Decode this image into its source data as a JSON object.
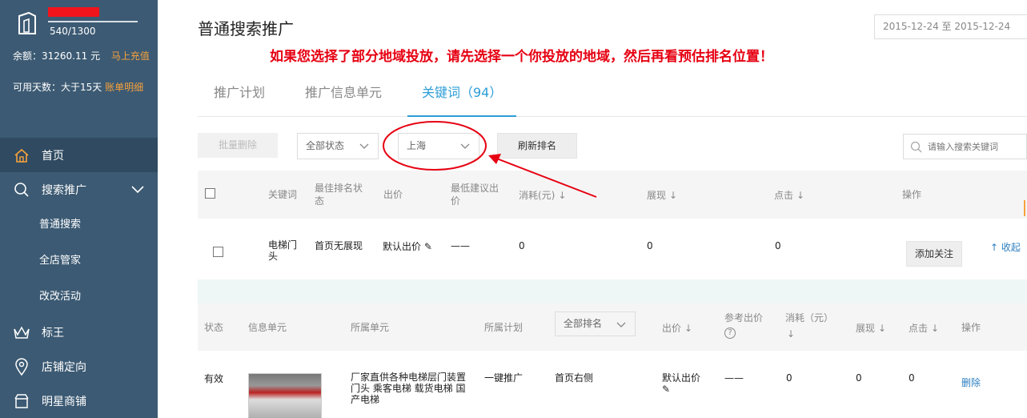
{
  "sidebar": {
    "score": "540/1300",
    "balance_label": "余额：31260.11 元",
    "recharge_link": "马上充值",
    "days_label": "可用天数：大于15天",
    "bill_link": "账单明细",
    "nav": {
      "home": "首页",
      "search_promo": "搜索推广",
      "normal_search": "普通搜索",
      "shop_manager": "全店管家",
      "gaigai": "改改活动",
      "biaowang": "标王",
      "shop_location": "店铺定向",
      "star_shop": "明星商铺"
    }
  },
  "main": {
    "title": "普通搜索推广",
    "date_range": "2015-12-24 至 2015-12-24",
    "notice": "如果您选择了部分地域投放，请先选择一个你投放的地域，然后再看预估排名位置！",
    "tabs": {
      "plan": "推广计划",
      "unit": "推广信息单元",
      "keyword": "关键词（94）"
    },
    "toolbar": {
      "batch_delete": "批量删除",
      "status_select": "全部状态",
      "region_select": "上海",
      "refresh_rank": "刷新排名",
      "search_placeholder": "请输入搜索关键词"
    },
    "table1": {
      "headers": {
        "keyword": "关键词",
        "best_rank": "最佳排名状态",
        "bid": "出价",
        "min_bid": "最低建议出价",
        "cost": "消耗(元)",
        "impressions": "展现",
        "clicks": "点击",
        "actions": "操作"
      },
      "row": {
        "keyword": "电梯门头",
        "best_rank": "首页无展现",
        "bid": "默认出价",
        "min_bid": "——",
        "cost": "0",
        "impressions": "0",
        "clicks": "0",
        "follow": "添加关注",
        "collapse": "收起"
      }
    },
    "table2": {
      "headers": {
        "status": "状态",
        "info_unit": "信息单元",
        "unit": "所属单元",
        "plan": "所属计划",
        "rank_select": "全部排名",
        "bid": "出价",
        "ref_bid": "参考出价",
        "cost": "消耗（元）",
        "impressions": "展现",
        "clicks": "点击",
        "actions": "操作"
      },
      "row": {
        "status": "有效",
        "unit": "厂家直供各种电梯层门装置门头 乘客电梯 载货电梯 国产电梯",
        "plan": "一键推广",
        "rank": "首页右侧",
        "bid": "默认出价",
        "ref_bid": "——",
        "cost": "0",
        "impressions": "0",
        "clicks": "0",
        "delete": "删除"
      }
    }
  },
  "colors": {
    "sidebar_bg": "#3c5a73",
    "accent_blue": "#2d9ed7",
    "notice_red": "#e60012",
    "link_orange": "#f7a23c"
  }
}
